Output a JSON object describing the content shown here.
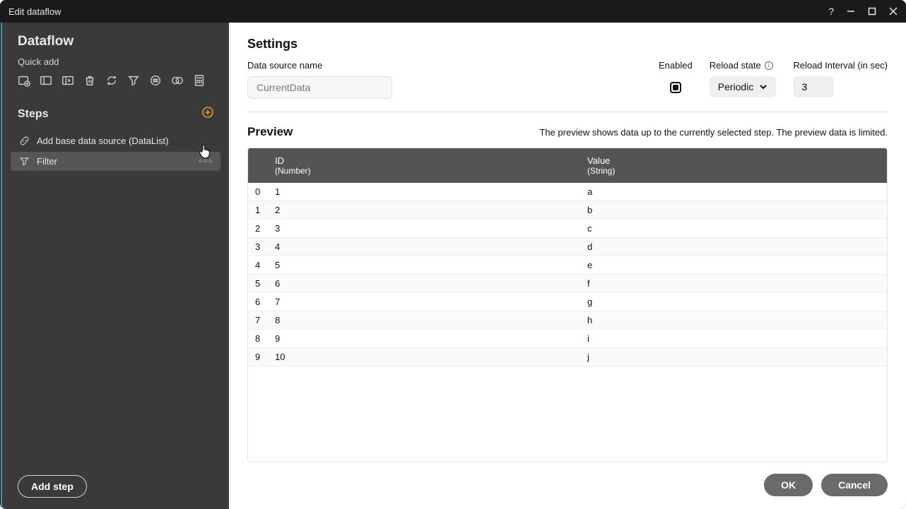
{
  "titlebar": {
    "title": "Edit dataflow"
  },
  "sidebar": {
    "title": "Dataflow",
    "quickAddLabel": "Quick add",
    "stepsLabel": "Steps",
    "steps": [
      {
        "label": "Add base data source (DataList)"
      },
      {
        "label": "Filter"
      }
    ],
    "addStepLabel": "Add step"
  },
  "settings": {
    "title": "Settings",
    "dataSourceName": {
      "label": "Data source name",
      "placeholder": "CurrentData",
      "value": ""
    },
    "enabled": {
      "label": "Enabled",
      "checked": true
    },
    "reloadState": {
      "label": "Reload state",
      "selected": "Periodic"
    },
    "reloadInterval": {
      "label": "Reload Interval (in sec)",
      "value": "3"
    }
  },
  "preview": {
    "title": "Preview",
    "note": "The preview shows data up to the currently selected step. The preview data is limited.",
    "columns": [
      {
        "name": "ID",
        "type": "(Number)"
      },
      {
        "name": "Value",
        "type": "(String)"
      }
    ],
    "rows": [
      {
        "idx": "0",
        "id": "1",
        "value": "a"
      },
      {
        "idx": "1",
        "id": "2",
        "value": "b"
      },
      {
        "idx": "2",
        "id": "3",
        "value": "c"
      },
      {
        "idx": "3",
        "id": "4",
        "value": "d"
      },
      {
        "idx": "4",
        "id": "5",
        "value": "e"
      },
      {
        "idx": "5",
        "id": "6",
        "value": "f"
      },
      {
        "idx": "6",
        "id": "7",
        "value": "g"
      },
      {
        "idx": "7",
        "id": "8",
        "value": "h"
      },
      {
        "idx": "8",
        "id": "9",
        "value": "i"
      },
      {
        "idx": "9",
        "id": "10",
        "value": "j"
      }
    ]
  },
  "buttons": {
    "ok": "OK",
    "cancel": "Cancel"
  }
}
